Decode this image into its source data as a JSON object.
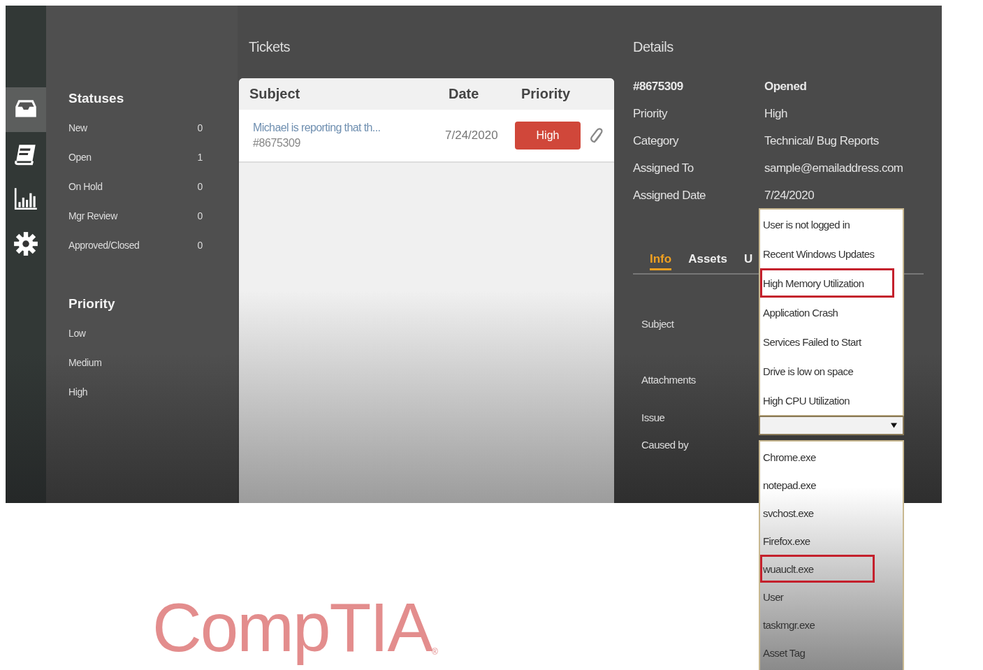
{
  "nav_rail": {
    "items": [
      {
        "kind": "inbox",
        "selected": true
      },
      {
        "kind": "book",
        "selected": false
      },
      {
        "kind": "chart",
        "selected": false
      },
      {
        "kind": "settings",
        "selected": false
      }
    ]
  },
  "sidebar": {
    "statuses": {
      "heading": "Statuses",
      "items": [
        {
          "label": "New",
          "count": "0"
        },
        {
          "label": "Open",
          "count": "1"
        },
        {
          "label": "On Hold",
          "count": "0"
        },
        {
          "label": "Mgr Review",
          "count": "0"
        },
        {
          "label": "Approved/Closed",
          "count": "0"
        }
      ]
    },
    "priority": {
      "heading": "Priority",
      "items": [
        {
          "label": "Low"
        },
        {
          "label": "Medium"
        },
        {
          "label": "High"
        }
      ]
    }
  },
  "tickets": {
    "title": "Tickets",
    "columns": [
      "Subject",
      "Date",
      "Priority"
    ],
    "rows": [
      {
        "subject": "Michael is reporting that th...",
        "id": "#8675309",
        "date": "7/24/2020",
        "priority": "High",
        "color": "#d0473a",
        "attachment": true
      }
    ]
  },
  "details": {
    "title": "Details",
    "id": "#8675309",
    "status": "Opened",
    "fields": [
      {
        "label": "Priority",
        "value": "High"
      },
      {
        "label": "Category",
        "value": "Technical/ Bug Reports"
      },
      {
        "label": "Assigned To",
        "value": "sample@emailaddress.com"
      },
      {
        "label": "Assigned Date",
        "value": "7/24/2020"
      }
    ],
    "tabs": [
      {
        "label": "Info",
        "selected": true
      },
      {
        "label": "Assets",
        "selected": false
      },
      {
        "label": "U",
        "selected": false
      }
    ],
    "form_labels": [
      "Subject",
      "Attachments",
      "Issue",
      "Caused by"
    ]
  },
  "issue_dropdown": {
    "options": [
      {
        "label": "User is not logged in",
        "highlighted": false
      },
      {
        "label": "Recent Windows Updates",
        "highlighted": false
      },
      {
        "label": "High Memory Utilization",
        "highlighted": true
      },
      {
        "label": "Application Crash",
        "highlighted": false
      },
      {
        "label": "Services Failed to Start",
        "highlighted": false
      },
      {
        "label": "Drive is low on space",
        "highlighted": false
      },
      {
        "label": "High CPU Utilization",
        "highlighted": false
      }
    ]
  },
  "caused_by_dropdown": {
    "options": [
      {
        "label": "Chrome.exe",
        "highlighted": false
      },
      {
        "label": "notepad.exe",
        "highlighted": false
      },
      {
        "label": "svchost.exe",
        "highlighted": false
      },
      {
        "label": "Firefox.exe",
        "highlighted": false
      },
      {
        "label": "wuauclt.exe",
        "highlighted": true
      },
      {
        "label": "User",
        "highlighted": false
      },
      {
        "label": "taskmgr.exe",
        "highlighted": false
      },
      {
        "label": "Asset Tag",
        "highlighted": false
      }
    ]
  },
  "logo": {
    "text": "CompTIA",
    "mark": "®"
  }
}
